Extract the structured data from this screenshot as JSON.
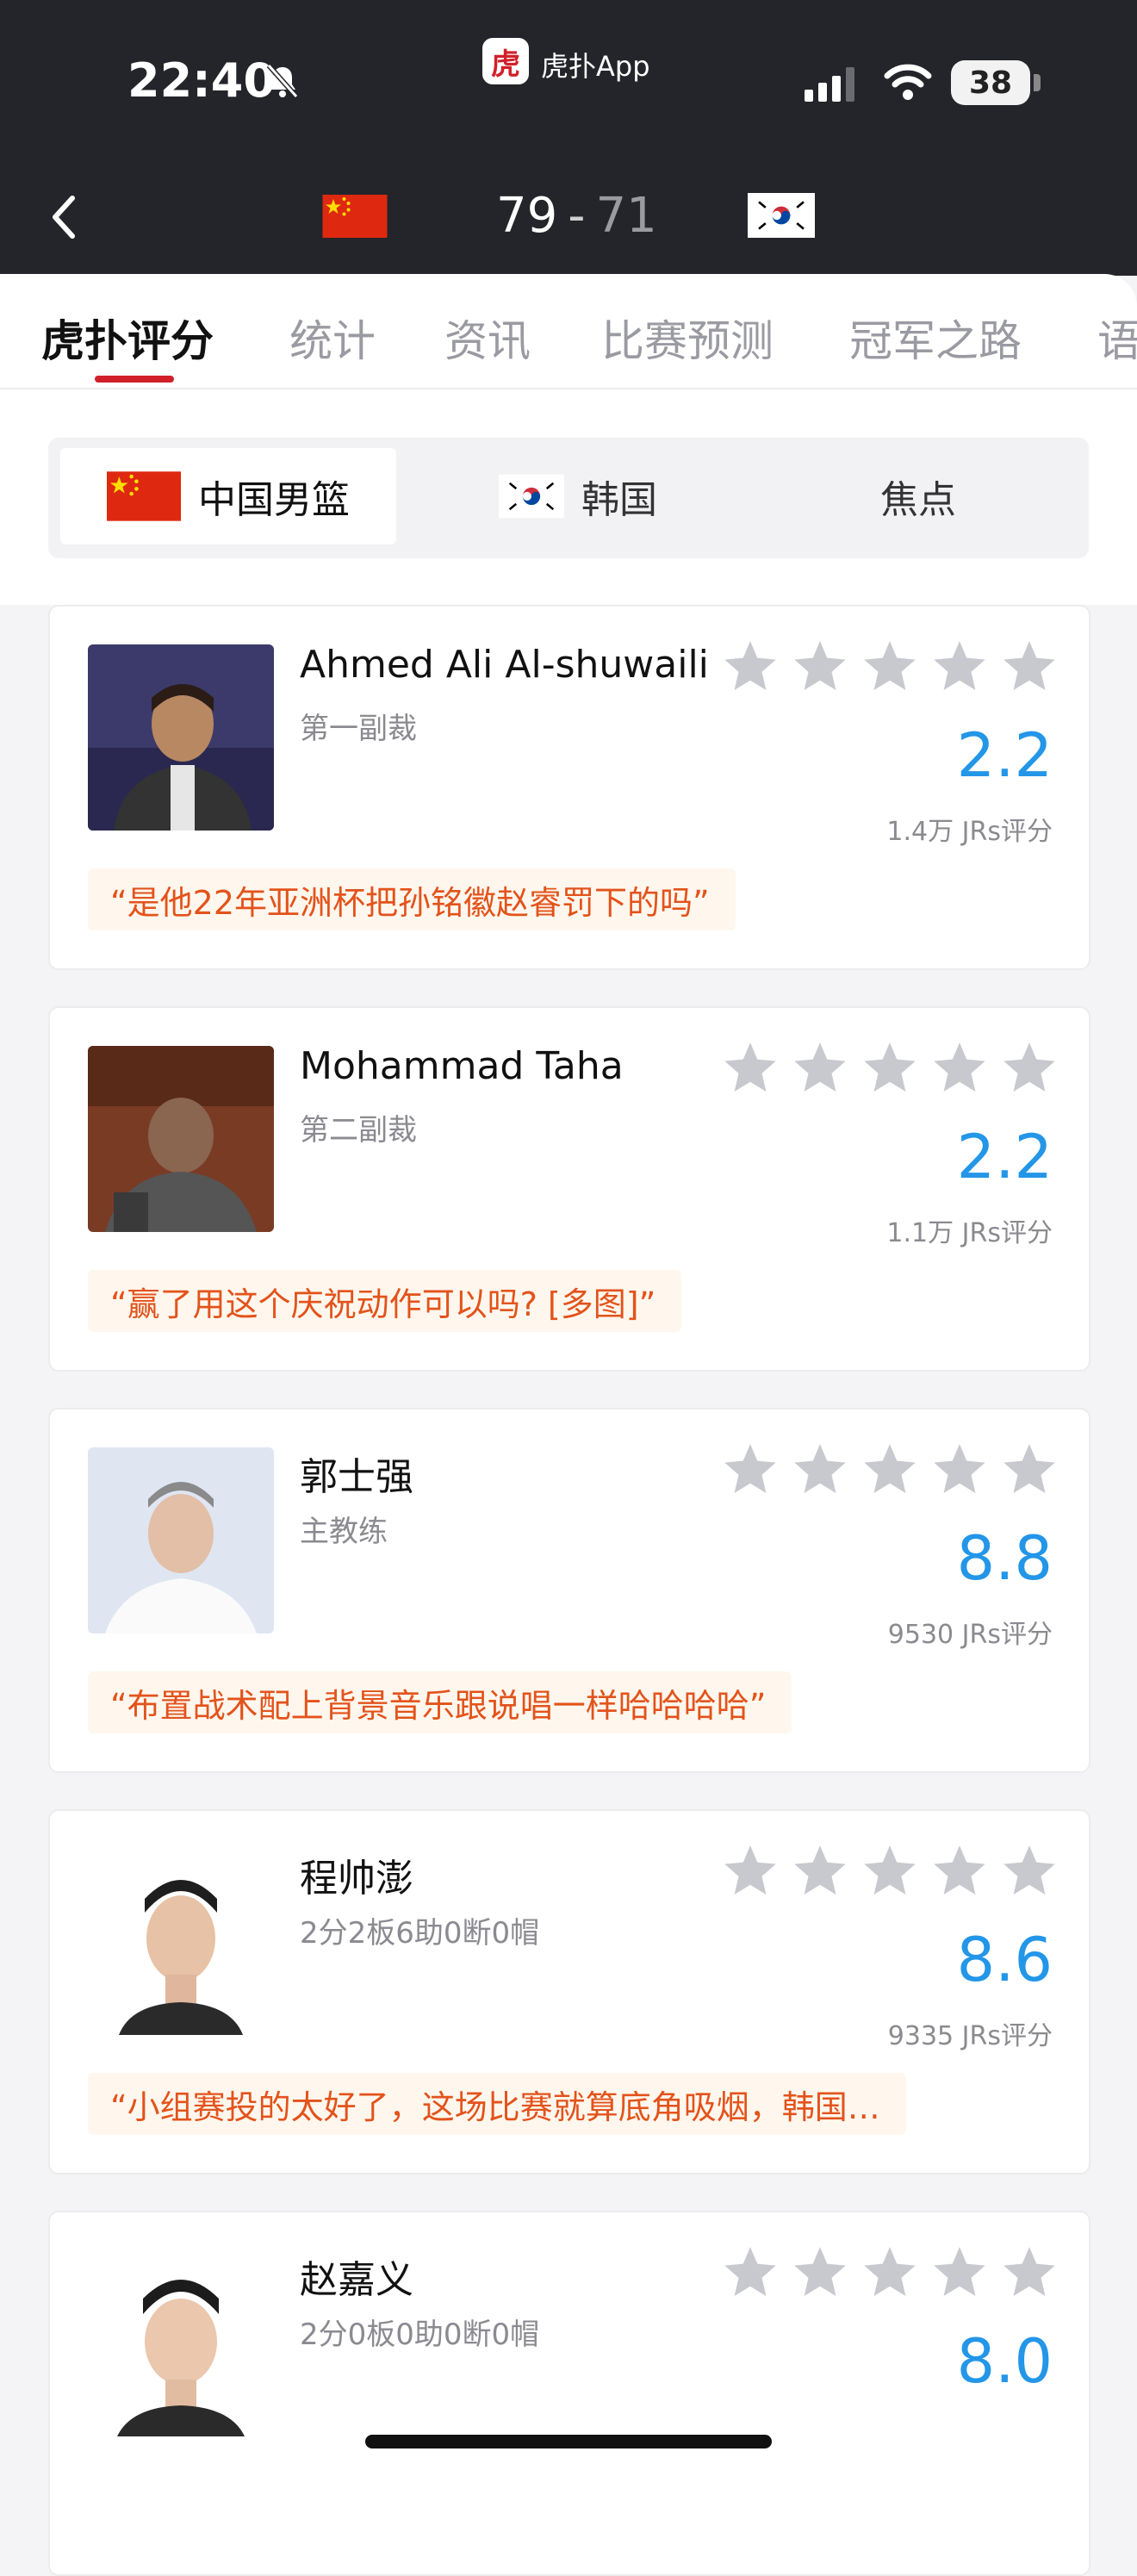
{
  "status_bar": {
    "time": "22:40",
    "battery": "38"
  },
  "app": {
    "badge": "虎",
    "name": "虎扑App"
  },
  "score": {
    "home": "79",
    "separator": "-",
    "away": "71"
  },
  "tabs": [
    "虎扑评分",
    "统计",
    "资讯",
    "比赛预测",
    "冠军之路",
    "语"
  ],
  "team_switch": [
    "中国男篮",
    "韩国",
    "焦点"
  ],
  "icons": {
    "back": "chevron-left-icon",
    "mute": "bell-slash-icon",
    "signal": "cellular-signal-icon",
    "wifi": "wifi-icon",
    "star": "star-icon"
  },
  "colors": {
    "header_bg": "#24252a",
    "accent_red": "#d0212a",
    "rating_blue": "#2396e8",
    "quote_orange": "#e3531b",
    "star_gray": "#c8c8cf"
  },
  "cards": [
    {
      "name": "Ahmed Ali Al-shuwaili",
      "role": "第一副裁",
      "rating": "2.2",
      "count": "1.4万 JRs评分",
      "quote": "“是他22年亚洲杯把孙铭徽赵睿罚下的吗”"
    },
    {
      "name": "Mohammad Taha",
      "role": "第二副裁",
      "rating": "2.2",
      "count": "1.1万 JRs评分",
      "quote": "“赢了用这个庆祝动作可以吗? [多图]”"
    },
    {
      "name": "郭士强",
      "role": "主教练",
      "rating": "8.8",
      "count": "9530 JRs评分",
      "quote": "“布置战术配上背景音乐跟说唱一样哈哈哈哈”"
    },
    {
      "name": "程帅澎",
      "role": "2分2板6助0断0帽",
      "rating": "8.6",
      "count": "9335 JRs评分",
      "quote": "“小组赛投的太好了，这场比赛就算底角吸烟，韩国…"
    },
    {
      "name": "赵嘉义",
      "role": "2分0板0助0断0帽",
      "rating": "8.0",
      "count": "",
      "quote": ""
    }
  ]
}
